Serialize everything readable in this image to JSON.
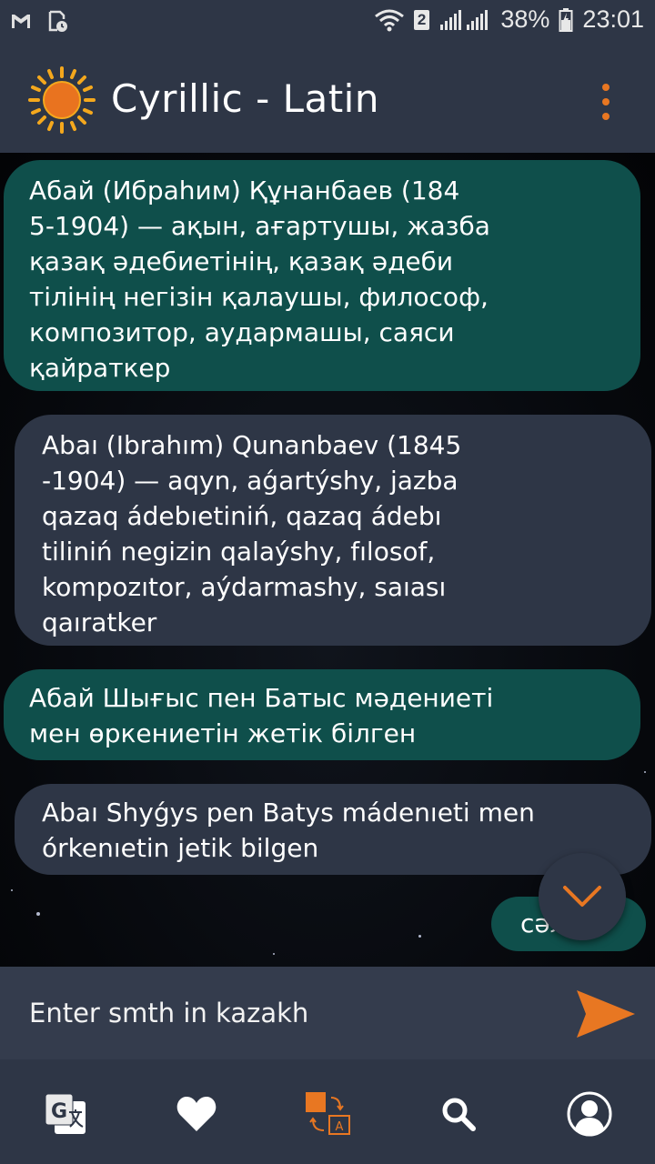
{
  "status_bar": {
    "sim_badge": "2",
    "battery": "38%",
    "time": "23:01",
    "icons": [
      "gmail-icon",
      "clock-file-icon",
      "wifi-icon",
      "signal-icon",
      "battery-charging-icon"
    ]
  },
  "app_bar": {
    "title": "Cyrillic - Latin",
    "logo": "sun-icon",
    "menu": "overflow-menu-icon"
  },
  "messages": [
    {
      "script": "cyrillic",
      "text": "Абай (Ибраһим) Құнанбаев (184\n5-1904) — ақын, ағартушы, жазба\nқазақ әдебиетінің, қазақ әдеби\nтілінің негізін қалаушы, философ,\nкомпозитор, аудармашы, саяси\nқайраткер"
    },
    {
      "script": "latin",
      "text": "Abaı (Ibrahım) Qunanbaev (1845\n-1904) — aqyn, aǵartýshy, jazba\nqazaq ádebıetiniń, qazaq ádebı\ntiliniń negizin qalaýshy, fılosof,\nkompozıtor, aýdarmashy, saıası\nqaıratker"
    },
    {
      "script": "cyrillic",
      "text": "Абай Шығыс пен Батыс мәдениеті\nмен өркениетін жетік білген"
    },
    {
      "script": "latin",
      "text": "Abaı Shyǵys pen Batys mádenıeti men\nórkenıetin jetik bilgen"
    },
    {
      "script": "cyrillic",
      "text": "сәлем"
    }
  ],
  "input": {
    "placeholder": "Enter smth in kazakh",
    "send_icon": "send-icon"
  },
  "bottom_nav": [
    {
      "name": "translate",
      "icon": "google-translate-icon"
    },
    {
      "name": "favorites",
      "icon": "heart-icon"
    },
    {
      "name": "transliterate",
      "icon": "transliterate-icon",
      "active": true
    },
    {
      "name": "search",
      "icon": "search-icon"
    },
    {
      "name": "profile",
      "icon": "profile-icon"
    }
  ],
  "colors": {
    "background": "#2e3646",
    "accent": "#e87722",
    "cyrillic_bubble": "#0f4f4b",
    "latin_bubble": "#2e3646"
  }
}
